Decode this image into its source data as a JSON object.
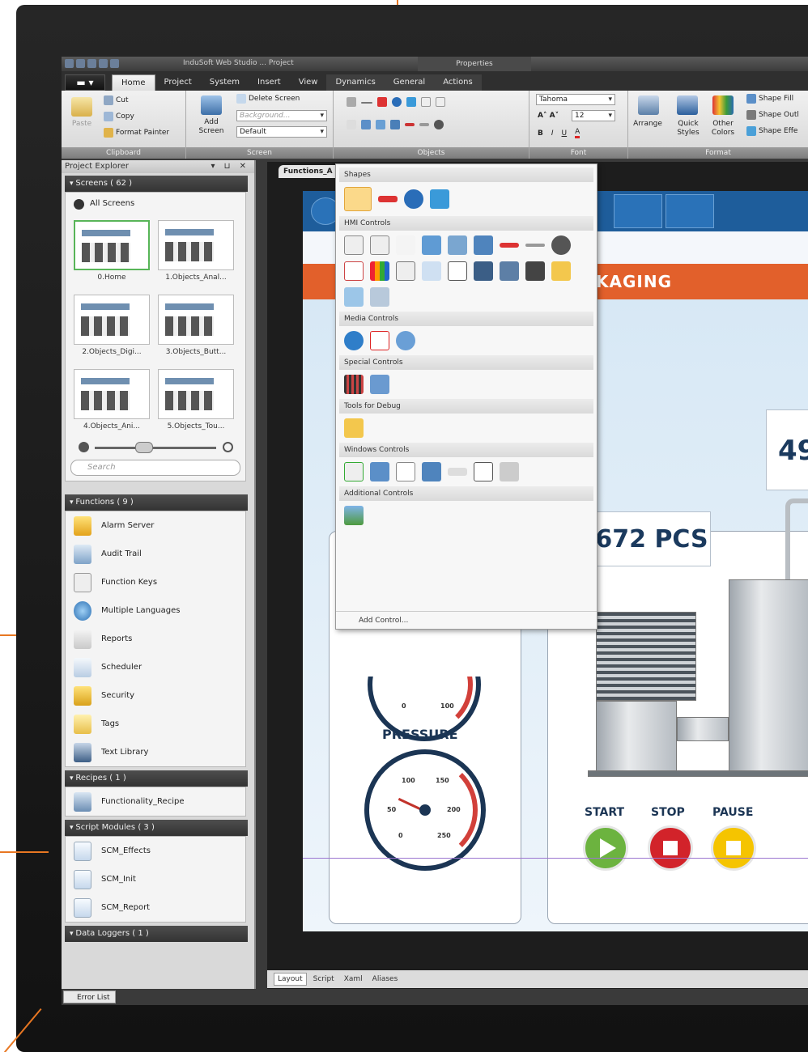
{
  "title_bar": {
    "app_title": "InduSoft Web Studio ... Project",
    "context_tab": "Properties"
  },
  "tabs": [
    "Home",
    "Project",
    "System",
    "Insert",
    "View",
    "Dynamics",
    "General",
    "Actions"
  ],
  "ribbon": {
    "clipboard": {
      "paste": "Paste",
      "cut": "Cut",
      "copy": "Copy",
      "format_painter": "Format Painter",
      "label": "Clipboard"
    },
    "screen": {
      "add_screen": "Add Screen",
      "delete_screen": "Delete Screen",
      "background": "Background...",
      "default": "Default",
      "label": "Screen"
    },
    "objects_label": "Objects",
    "font": {
      "family": "Tahoma",
      "size": "12",
      "label": "Font",
      "bold": "B",
      "italic": "I",
      "underline": "U"
    },
    "format": {
      "arrange": "Arrange",
      "quick_styles": "Quick Styles",
      "other_colors": "Other Colors",
      "shape_fill": "Shape Fill",
      "shape_outline": "Shape Outl",
      "shape_effects": "Shape Effe",
      "label": "Format"
    }
  },
  "project_explorer": {
    "title": "Project Explorer",
    "screens_header": "Screens ( 62 )",
    "all_screens": "All Screens",
    "thumbs": [
      "0.Home",
      "1.Objects_Anal...",
      "2.Objects_Digi...",
      "3.Objects_Butt...",
      "4.Objects_Ani...",
      "5.Objects_Tou..."
    ],
    "search_placeholder": "Search",
    "functions_header": "Functions ( 9 )",
    "functions": [
      "Alarm Server",
      "Audit Trail",
      "Function Keys",
      "Multiple Languages",
      "Reports",
      "Scheduler",
      "Security",
      "Tags",
      "Text Library"
    ],
    "recipes_header": "Recipes ( 1 )",
    "recipes": [
      "Functionality_Recipe"
    ],
    "scripts_header": "Script Modules ( 3 )",
    "scripts": [
      "SCM_Effects",
      "SCM_Init",
      "SCM_Report"
    ],
    "dataloggers_header": "Data Loggers ( 1 )"
  },
  "status": {
    "error_list": "Error List"
  },
  "document": {
    "tab": "Functions_A",
    "banner_text": "KAGING",
    "bubble1": "672 PCS",
    "bubble2": "49",
    "pressure_label": "PRESSURE",
    "gauge_top_labels": [
      "0",
      "100"
    ],
    "gauge_labels": [
      "100",
      "150",
      "50",
      "200",
      "0",
      "250"
    ],
    "controls": [
      "START",
      "STOP",
      "PAUSE"
    ],
    "bottom_tabs": [
      "Layout",
      "Script",
      "Xaml",
      "Aliases"
    ]
  },
  "dropdown": {
    "categories": [
      "Shapes",
      "HMI Controls",
      "Media Controls",
      "Special Controls",
      "Tools for Debug",
      "Windows Controls",
      "Additional Controls"
    ],
    "add_control": "Add Control..."
  },
  "colors": {
    "accent": "#e87722",
    "banner": "#1e5d9b",
    "orange_bar": "#e2602b",
    "start": "#6cb33f",
    "stop": "#d2232a",
    "pause": "#f5c400"
  }
}
